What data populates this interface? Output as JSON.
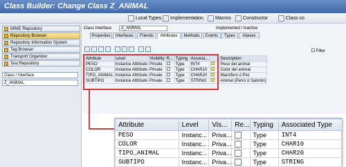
{
  "window": {
    "title": "Class Builder: Change Class Z_ANIMAL"
  },
  "toolbar": {
    "items": [
      "Local Types",
      "Implementation",
      "Macros",
      "Constructor",
      "Class co"
    ]
  },
  "navigation": {
    "items": [
      "MIME Repository",
      "Repository Browser",
      "Repository Information System",
      "Tag Browser",
      "Transport Organizer",
      "Test Repository"
    ],
    "object_type": "Class / Interface",
    "object_name": "Z_ANIMAL"
  },
  "header": {
    "class_label": "Class Interface",
    "class_value": "Z_ANIMAL",
    "status": "Implemented / Inactive"
  },
  "tabs": [
    "Properties",
    "Interfaces",
    "Friends",
    "Attributes",
    "Methods",
    "Events",
    "Types",
    "Aliases"
  ],
  "filter_label": "Filter",
  "small_table": {
    "headers": [
      "Attribute",
      "Level",
      "Visibility",
      "R...",
      "Typing",
      "Associa...",
      "Description"
    ],
    "rows": [
      {
        "attribute": "PESO",
        "level": "Instance Attribute",
        "visibility": "Private",
        "typing": "Type",
        "assoc": "INT4",
        "description": "Peso del animal"
      },
      {
        "attribute": "COLOR",
        "level": "Instance Attribute",
        "visibility": "Private",
        "typing": "Type",
        "assoc": "CHAR10",
        "description": "Color del animal"
      },
      {
        "attribute": "TIPO_ANIMAL",
        "level": "Instance Attribute",
        "visibility": "Private",
        "typing": "Type",
        "assoc": "CHAR20",
        "description": "Mamífero ó Pez"
      },
      {
        "attribute": "SUBTIPO",
        "level": "Instance Attribute",
        "visibility": "Private",
        "typing": "Type",
        "assoc": "STRING",
        "description": "Animal (Perro ó Salmón)"
      }
    ]
  },
  "zoom_table": {
    "headers": [
      "Attribute",
      "Level",
      "Vis...",
      "Re...",
      "Typing",
      "Associated Type"
    ],
    "rows": [
      {
        "attribute": "PESO",
        "level": "Instanc...",
        "visibility": "Priva...",
        "typing": "Type",
        "assoc": "INT4"
      },
      {
        "attribute": "COLOR",
        "level": "Instanc...",
        "visibility": "Priva...",
        "typing": "Type",
        "assoc": "CHAR10"
      },
      {
        "attribute": "TIPO_ANIMAL",
        "level": "Instanc...",
        "visibility": "Priva...",
        "typing": "Type",
        "assoc": "CHAR20"
      },
      {
        "attribute": "SUBTIPO",
        "level": "Instanc...",
        "visibility": "Priva...",
        "typing": "Type",
        "assoc": "STRING"
      }
    ]
  },
  "colors": {
    "title_bar": "#4f7ab8",
    "highlight": "#cc3b3b",
    "selected_nav": "#f2c65a"
  }
}
